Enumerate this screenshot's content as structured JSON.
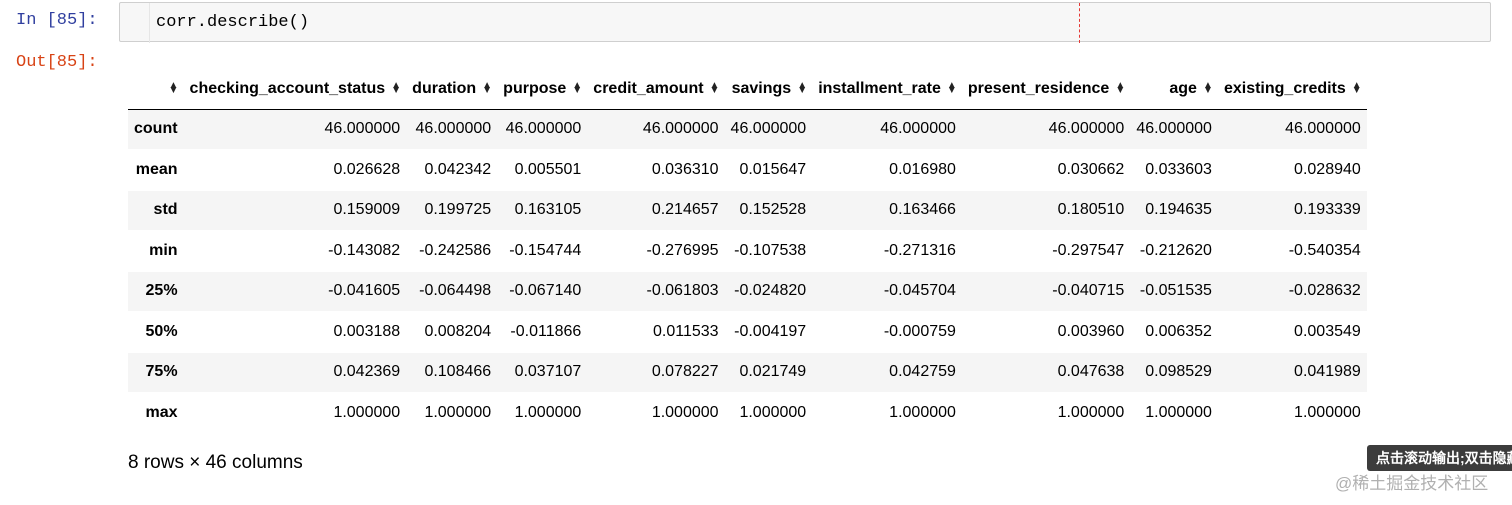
{
  "cell": {
    "in_prompt": "In [85]:",
    "out_prompt": "Out[85]:",
    "code": "corr.describe()"
  },
  "table": {
    "columns": [
      "checking_account_status",
      "duration",
      "purpose",
      "credit_amount",
      "savings",
      "installment_rate",
      "present_residence",
      "age",
      "existing_credits"
    ],
    "rows": [
      {
        "label": "count",
        "values": [
          "46.000000",
          "46.000000",
          "46.000000",
          "46.000000",
          "46.000000",
          "46.000000",
          "46.000000",
          "46.000000",
          "46.000000"
        ]
      },
      {
        "label": "mean",
        "values": [
          "0.026628",
          "0.042342",
          "0.005501",
          "0.036310",
          "0.015647",
          "0.016980",
          "0.030662",
          "0.033603",
          "0.028940"
        ]
      },
      {
        "label": "std",
        "values": [
          "0.159009",
          "0.199725",
          "0.163105",
          "0.214657",
          "0.152528",
          "0.163466",
          "0.180510",
          "0.194635",
          "0.193339"
        ]
      },
      {
        "label": "min",
        "values": [
          "-0.143082",
          "-0.242586",
          "-0.154744",
          "-0.276995",
          "-0.107538",
          "-0.271316",
          "-0.297547",
          "-0.212620",
          "-0.540354"
        ]
      },
      {
        "label": "25%",
        "values": [
          "-0.041605",
          "-0.064498",
          "-0.067140",
          "-0.061803",
          "-0.024820",
          "-0.045704",
          "-0.040715",
          "-0.051535",
          "-0.028632"
        ]
      },
      {
        "label": "50%",
        "values": [
          "0.003188",
          "0.008204",
          "-0.011866",
          "0.011533",
          "-0.004197",
          "-0.000759",
          "0.003960",
          "0.006352",
          "0.003549"
        ]
      },
      {
        "label": "75%",
        "values": [
          "0.042369",
          "0.108466",
          "0.037107",
          "0.078227",
          "0.021749",
          "0.042759",
          "0.047638",
          "0.098529",
          "0.041989"
        ]
      },
      {
        "label": "max",
        "values": [
          "1.000000",
          "1.000000",
          "1.000000",
          "1.000000",
          "1.000000",
          "1.000000",
          "1.000000",
          "1.000000",
          "1.000000"
        ]
      }
    ]
  },
  "summary": "8 rows × 46 columns",
  "tooltip": "点击滚动输出;双击隐藏",
  "watermark": "@稀土掘金技术社区"
}
